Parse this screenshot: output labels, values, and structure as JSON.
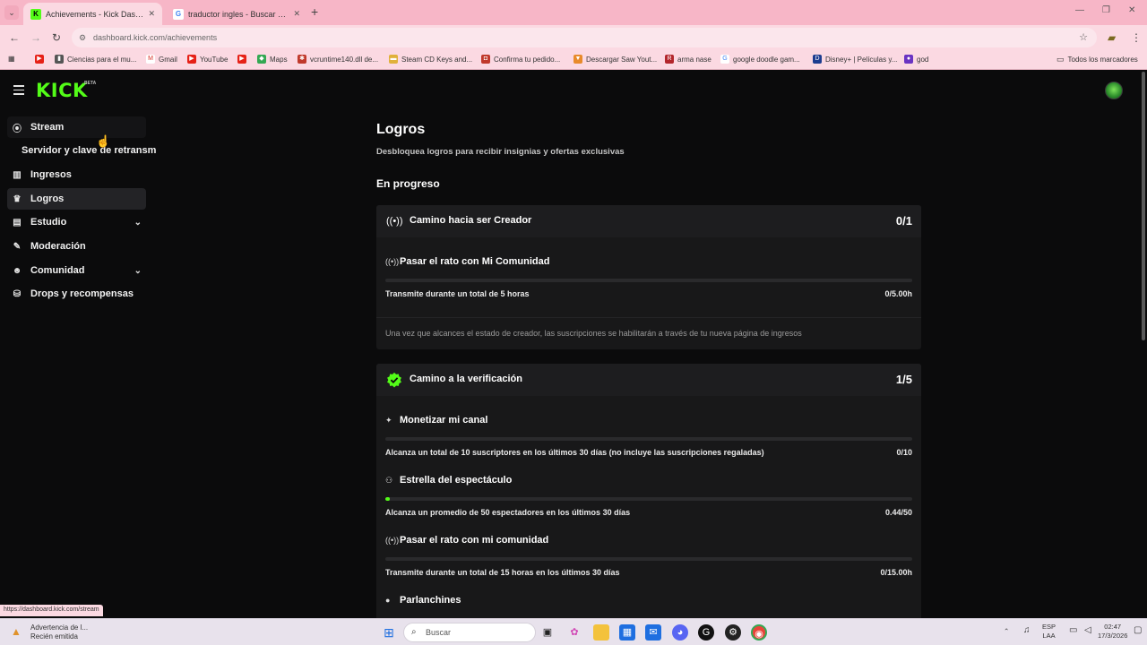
{
  "browser": {
    "tabs": [
      {
        "title": "Achievements - Kick Dashboard",
        "active": true
      },
      {
        "title": "traductor ingles - Buscar con G",
        "active": false
      }
    ],
    "url": "dashboard.kick.com/achievements",
    "bookmarks": [
      "",
      "Ciencias para el mu...",
      "Gmail",
      "YouTube",
      "",
      "Maps",
      "vcruntime140.dll de...",
      "Steam CD Keys and...",
      "Confirma tu pedido...",
      "Descargar Saw Yout...",
      "arma nase",
      "google doodle gam...",
      "Disney+ | Películas y...",
      "god"
    ],
    "all_bookmarks": "Todos los marcadores",
    "status_link": "https://dashboard.kick.com/stream"
  },
  "app": {
    "logo": "KICK",
    "logo_badge": "BETA",
    "sidebar": {
      "items": [
        {
          "label": "Stream",
          "icon": "broadcast-icon"
        },
        {
          "label": "Ingresos",
          "icon": "chart-icon"
        },
        {
          "label": "Logros",
          "icon": "trophy-icon"
        },
        {
          "label": "Estudio",
          "icon": "studio-icon"
        },
        {
          "label": "Moderación",
          "icon": "wrench-icon"
        },
        {
          "label": "Comunidad",
          "icon": "people-icon"
        },
        {
          "label": "Drops y recompensas",
          "icon": "gift-icon"
        }
      ],
      "stream_sub": "Servidor y clave de retransm"
    },
    "page": {
      "title": "Logros",
      "subtitle": "Desbloquea logros para recibir insignias y ofertas exclusivas",
      "section": "En progreso"
    },
    "cards": [
      {
        "title": "Camino hacia ser Creador",
        "count": "0/1",
        "goals": [
          {
            "title": "Pasar el rato con Mi Comunidad",
            "desc": "Transmite durante un total de 5 horas",
            "value": "0/5.00h",
            "progress": 0
          }
        ],
        "note": "Una vez que alcances el estado de creador, las suscripciones se habilitarán a través de tu nueva página de ingresos"
      },
      {
        "title": "Camino a la verificación",
        "count": "1/5",
        "goals": [
          {
            "title": "Monetizar mi canal",
            "desc": "Alcanza un total de 10 suscriptores en los últimos 30 días (no incluye las suscripciones regaladas)",
            "value": "0/10",
            "progress": 0
          },
          {
            "title": "Estrella del espectáculo",
            "desc": "Alcanza un promedio de 50 espectadores en los últimos 30 días",
            "value": "0.44/50",
            "progress": 0.0088
          },
          {
            "title": "Pasar el rato con mi comunidad",
            "desc": "Transmite durante un total de 15 horas en los últimos 30 días",
            "value": "0/15.00h",
            "progress": 0
          },
          {
            "title": "Parlanchines"
          }
        ]
      }
    ],
    "accent": "#53fc18"
  },
  "taskbar": {
    "alert_title": "Advertencia de l...",
    "alert_sub": "Recién emitida",
    "search": "Buscar",
    "lang_top": "ESP",
    "lang_bottom": "LAA",
    "time": "02:47",
    "date": "17/3/2026"
  }
}
